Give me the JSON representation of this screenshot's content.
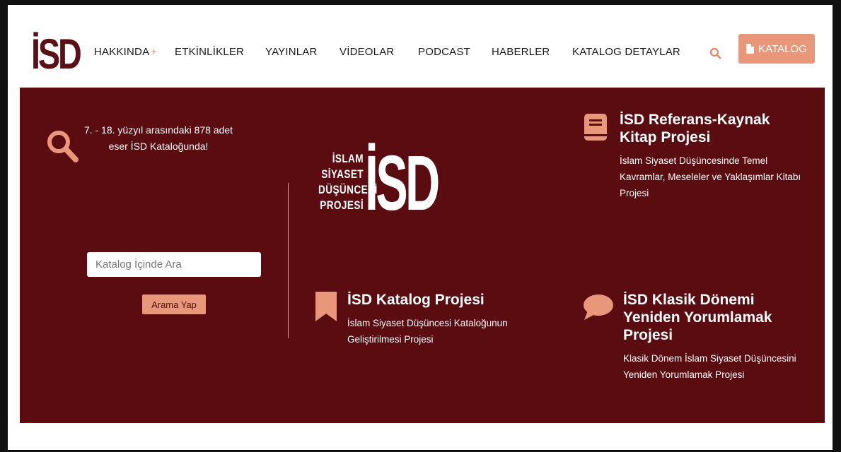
{
  "header": {
    "logo_text": "İSD",
    "nav": [
      {
        "label": "HAKKINDA",
        "has_plus": "+"
      },
      {
        "label": "ETKİNLİKLER"
      },
      {
        "label": "YAYINLAR"
      },
      {
        "label": "VİDEOLAR"
      },
      {
        "label": "PODCAST"
      },
      {
        "label": "HABERLER"
      },
      {
        "label": "KATALOG DETAYLAR"
      }
    ],
    "catalog_button": "KATALOG"
  },
  "hero": {
    "intro_text": "7. - 18. yüzyıl arasındaki 878 adet eser İSD Kataloğunda!",
    "search": {
      "placeholder": "Katalog İçinde Ara",
      "value": "",
      "button": "Arama Yap"
    },
    "center_logo": {
      "words": [
        "İSLAM",
        "SİYASET",
        "DÜŞÜNCESİ",
        "PROJESİ"
      ],
      "big_text": "İSD"
    },
    "features": [
      {
        "icon": "book-icon",
        "title": "İSD Referans-Kaynak Kitap Projesi",
        "description": "İslam Siyaset Düşüncesinde Temel Kavramlar, Meseleler ve Yaklaşımlar Kitabı Projesi"
      },
      {
        "icon": "bookmark-icon",
        "title": "İSD Katalog Projesi",
        "description": "İslam Siyaset Düşüncesi Kataloğunun Geliştirilmesi Projesi"
      },
      {
        "icon": "speech-bubble-icon",
        "title": "İSD Klasik Dönemi Yeniden Yorumlamak Projesi",
        "description": "Klasik Dönem İslam Siyaset Düşüncesini Yeniden Yorumlamak Projesi"
      }
    ]
  },
  "colors": {
    "brand": "#5a0c11",
    "accent": "#e8977a",
    "outer_border": "#f4b21a"
  }
}
